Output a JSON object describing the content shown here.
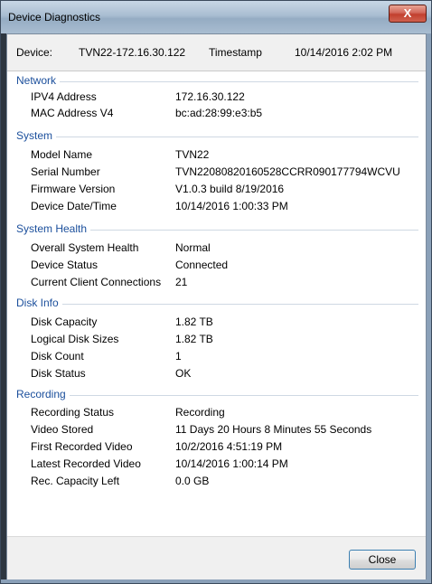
{
  "window": {
    "title": "Device Diagnostics",
    "close_glyph": "X"
  },
  "header": {
    "device_label": "Device:",
    "device_value": "TVN22-172.16.30.122",
    "timestamp_label": "Timestamp",
    "timestamp_value": "10/14/2016 2:02 PM"
  },
  "sections": [
    {
      "title": "Network",
      "rows": [
        {
          "label": "IPV4 Address",
          "value": "172.16.30.122"
        },
        {
          "label": "MAC Address V4",
          "value": "bc:ad:28:99:e3:b5"
        }
      ]
    },
    {
      "title": "System",
      "rows": [
        {
          "label": "Model Name",
          "value": "TVN22"
        },
        {
          "label": "Serial Number",
          "value": "TVN22080820160528CCRR090177794WCVU"
        },
        {
          "label": "Firmware Version",
          "value": "V1.0.3 build 8/19/2016"
        },
        {
          "label": "Device Date/Time",
          "value": "10/14/2016 1:00:33 PM"
        }
      ]
    },
    {
      "title": "System Health",
      "rows": [
        {
          "label": "Overall System Health",
          "value": "Normal"
        },
        {
          "label": "Device Status",
          "value": "Connected"
        },
        {
          "label": "Current Client Connections",
          "value": "21"
        }
      ]
    },
    {
      "title": "Disk Info",
      "rows": [
        {
          "label": "Disk Capacity",
          "value": "1.82 TB"
        },
        {
          "label": "Logical Disk Sizes",
          "value": "1.82 TB"
        },
        {
          "label": "Disk Count",
          "value": "1"
        },
        {
          "label": "Disk Status",
          "value": "OK"
        }
      ]
    },
    {
      "title": "Recording",
      "rows": [
        {
          "label": "Recording Status",
          "value": "Recording"
        },
        {
          "label": "Video Stored",
          "value": "11 Days 20 Hours 8 Minutes 55 Seconds"
        },
        {
          "label": "First Recorded Video",
          "value": "10/2/2016 4:51:19 PM"
        },
        {
          "label": "Latest Recorded Video",
          "value": "10/14/2016 1:00:14 PM"
        },
        {
          "label": "Rec. Capacity Left",
          "value": "0.0 GB"
        }
      ]
    }
  ],
  "footer": {
    "close_label": "Close"
  }
}
